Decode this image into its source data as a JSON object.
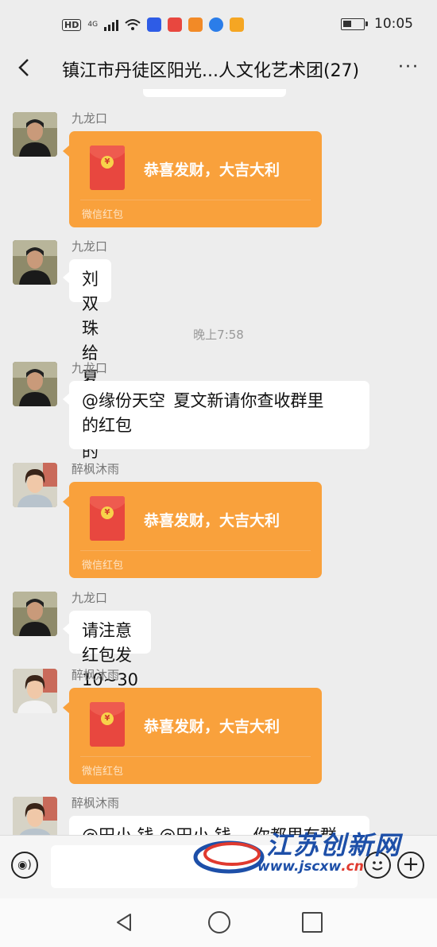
{
  "status_bar": {
    "hd": "HD",
    "network": "4G",
    "time": "10:05",
    "app_icons": [
      {
        "name": "baidu-icon",
        "color": "#2e5ce6"
      },
      {
        "name": "book-icon",
        "color": "#e8473f"
      },
      {
        "name": "video-icon",
        "color": "#f28a27"
      },
      {
        "name": "browser-icon",
        "color": "#2b7de9"
      },
      {
        "name": "app-icon",
        "color": "#f5a623"
      }
    ]
  },
  "header": {
    "title": "镇江市丹徒区阳光...人文化艺术团(27)",
    "more": "···"
  },
  "messages": {
    "m1": {
      "sender": "九龙口",
      "redpacket_text": "恭喜发财，大吉大利",
      "redpacket_label": "微信红包"
    },
    "m2": {
      "sender": "九龙口",
      "text": "刘双珠给夏文新的"
    },
    "timestamp": "晚上7:58",
    "m3": {
      "sender": "九龙口",
      "text_line1": "@缘份天空  夏文新请你查收群里",
      "text_line2": "的红包"
    },
    "m4": {
      "sender": "醉枫沐雨",
      "redpacket_text": "恭喜发财，大吉大利",
      "redpacket_label": "微信红包"
    },
    "m5": {
      "sender": "九龙口",
      "text": "请注意红包发 10~30 元"
    },
    "m6": {
      "sender": "醉枫沐雨",
      "redpacket_text": "恭喜发财，大吉大利",
      "redpacket_label": "微信红包"
    },
    "m7": {
      "sender": "醉枫沐雨",
      "text": "@田小 钱  @田小 钱  …你都里有群"
    }
  },
  "watermark": {
    "title": "江苏创新网",
    "url_prefix": "www.jscxw",
    "url_suffix": ".cn"
  },
  "colors": {
    "redpacket": "#f9a13c",
    "background": "#ededed",
    "watermark": "#1d4fa8"
  }
}
